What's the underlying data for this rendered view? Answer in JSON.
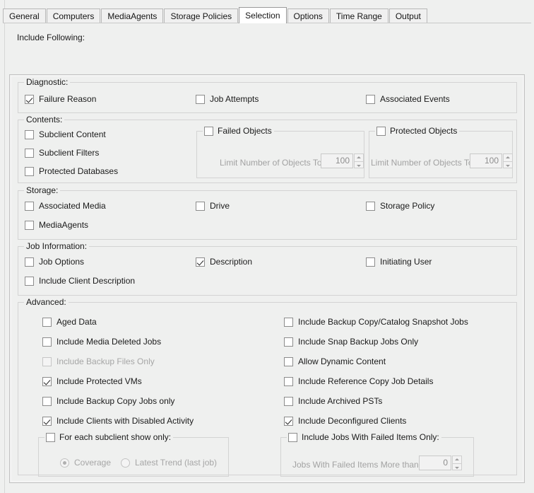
{
  "tabs": [
    {
      "label": "General",
      "active": false
    },
    {
      "label": "Computers",
      "active": false
    },
    {
      "label": "MediaAgents",
      "active": false
    },
    {
      "label": "Storage Policies",
      "active": false
    },
    {
      "label": "Selection",
      "active": true
    },
    {
      "label": "Options",
      "active": false
    },
    {
      "label": "Time Range",
      "active": false
    },
    {
      "label": "Output",
      "active": false
    }
  ],
  "page": {
    "include_following_label": "Include Following:"
  },
  "diagnostic": {
    "legend": "Diagnostic:",
    "items": [
      {
        "label": "Failure Reason",
        "checked": true,
        "disabled": false
      },
      {
        "label": "Job Attempts",
        "checked": false,
        "disabled": false
      },
      {
        "label": "Associated Events",
        "checked": false,
        "disabled": false
      }
    ]
  },
  "contents": {
    "legend": "Contents:",
    "items": [
      {
        "label": "Subclient Content",
        "checked": false,
        "disabled": false
      },
      {
        "label": "Subclient Filters",
        "checked": false,
        "disabled": false
      },
      {
        "label": "Protected Databases",
        "checked": false,
        "disabled": false
      }
    ],
    "failed_objects": {
      "legend": "Failed Objects",
      "checked": false,
      "limit_label": "Limit Number of Objects To:",
      "limit_value": "100"
    },
    "protected_objects": {
      "legend": "Protected Objects",
      "checked": false,
      "limit_label": "Limit Number of Objects To:",
      "limit_value": "100"
    }
  },
  "storage": {
    "legend": "Storage:",
    "items": [
      {
        "label": "Associated Media",
        "checked": false,
        "disabled": false
      },
      {
        "label": "Drive",
        "checked": false,
        "disabled": false
      },
      {
        "label": "Storage Policy",
        "checked": false,
        "disabled": false
      },
      {
        "label": "MediaAgents",
        "checked": false,
        "disabled": false
      }
    ]
  },
  "job_information": {
    "legend": "Job Information:",
    "items": [
      {
        "label": "Job Options",
        "checked": false,
        "disabled": false
      },
      {
        "label": "Description",
        "checked": true,
        "disabled": false
      },
      {
        "label": "Initiating User",
        "checked": false,
        "disabled": false
      },
      {
        "label": "Include Client Description",
        "checked": false,
        "disabled": false
      }
    ]
  },
  "advanced": {
    "legend": "Advanced:",
    "left_items": [
      {
        "label": "Aged Data",
        "checked": false,
        "disabled": false
      },
      {
        "label": "Include Media Deleted Jobs",
        "checked": false,
        "disabled": false
      },
      {
        "label": "Include Backup Files Only",
        "checked": false,
        "disabled": true
      },
      {
        "label": "Include Protected VMs",
        "checked": true,
        "disabled": false
      },
      {
        "label": "Include Backup Copy Jobs only",
        "checked": false,
        "disabled": false
      },
      {
        "label": "Include Clients with Disabled Activity",
        "checked": true,
        "disabled": false
      }
    ],
    "right_items": [
      {
        "label": "Include Backup Copy/Catalog Snapshot Jobs",
        "checked": false,
        "disabled": false
      },
      {
        "label": "Include Snap Backup Jobs Only",
        "checked": false,
        "disabled": false
      },
      {
        "label": "Allow Dynamic Content",
        "checked": false,
        "disabled": false
      },
      {
        "label": "Include Reference Copy Job Details",
        "checked": false,
        "disabled": false
      },
      {
        "label": "Include Archived PSTs",
        "checked": false,
        "disabled": false
      },
      {
        "label": "Include Deconfigured Clients",
        "checked": true,
        "disabled": false
      }
    ],
    "subclient_panel": {
      "legend": "For each subclient show only:",
      "checked": false,
      "radios": [
        {
          "label": "Coverage",
          "selected": true,
          "disabled": true
        },
        {
          "label": "Latest Trend (last job)",
          "selected": false,
          "disabled": true
        }
      ]
    },
    "failed_items_panel": {
      "legend": "Include Jobs With Failed Items Only:",
      "checked": false,
      "more_than_label": "Jobs With Failed Items More than:",
      "more_than_value": "0"
    }
  }
}
